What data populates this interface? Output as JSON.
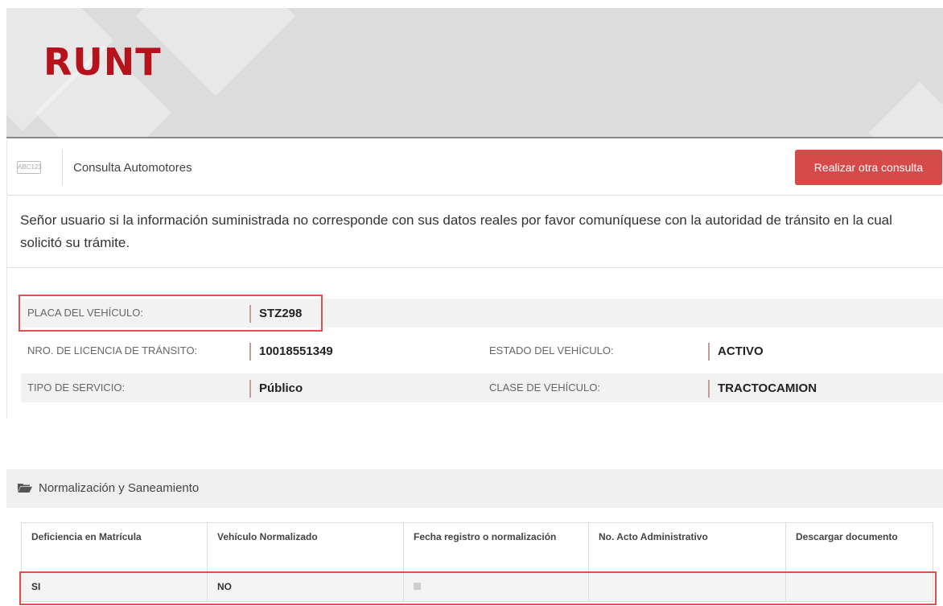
{
  "header": {
    "logo_text": "RUNT"
  },
  "bar": {
    "icon_text": "ABC123",
    "title": "Consulta Automotores",
    "button_label": "Realizar otra consulta"
  },
  "notice": "Señor usuario si la información suministrada no corresponde con sus datos reales por favor comuníquese con la autoridad de tránsito en la cual solicitó su trámite.",
  "vehicle": {
    "placa_label": "PLACA DEL VEHÍCULO:",
    "placa_value": "STZ298",
    "licencia_label": "NRO. DE LICENCIA DE TRÁNSITO:",
    "licencia_value": "10018551349",
    "estado_label": "ESTADO DEL VEHÍCULO:",
    "estado_value": "ACTIVO",
    "servicio_label": "TIPO DE SERVICIO:",
    "servicio_value": "Público",
    "clase_label": "CLASE DE VEHÍCULO:",
    "clase_value": "TRACTOCAMION"
  },
  "section": {
    "title": "Normalización y Saneamiento",
    "columns": [
      "Deficiencia en Matrícula",
      "Vehículo Normalizado",
      "Fecha registro o normalización",
      "No. Acto Administrativo",
      "Descargar documento"
    ],
    "row": [
      "SI",
      "NO",
      "",
      "",
      ""
    ]
  },
  "colors": {
    "brand": "#b5121b",
    "button": "#d64a4a",
    "highlight": "#e05050"
  },
  "icons": {
    "bar_icon": "abc123-icon",
    "section_icon": "folder-open-icon",
    "date_icon": "calendar-icon"
  }
}
